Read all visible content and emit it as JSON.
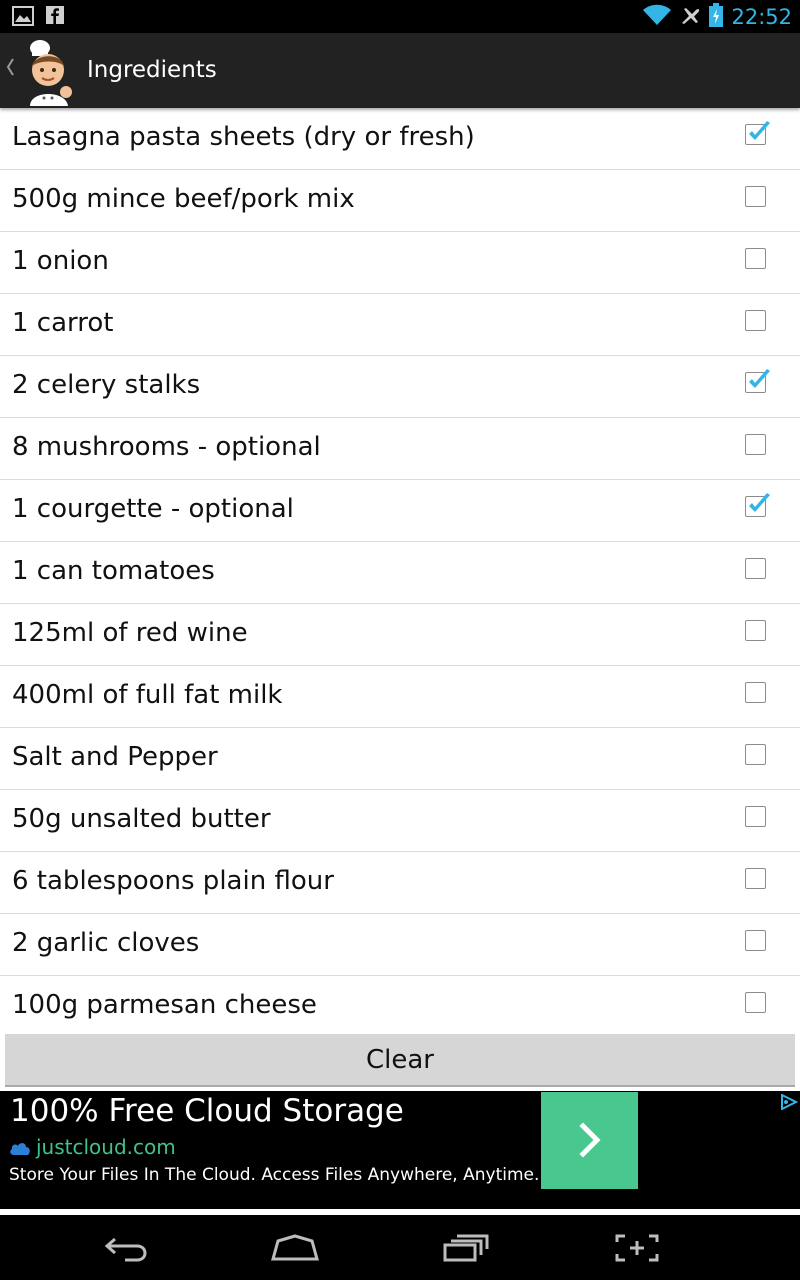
{
  "status_bar": {
    "time": "22:52",
    "left_icons": [
      "gallery-icon",
      "facebook-icon"
    ],
    "right_icons": [
      "wifi-icon",
      "airplane-mode-icon",
      "battery-charging-icon"
    ],
    "accent_color": "#33b5e5"
  },
  "action_bar": {
    "title": "Ingredients",
    "up_icon": "chevron-left-icon",
    "app_icon": "chef-icon"
  },
  "ingredients": [
    {
      "label": "Lasagna pasta sheets (dry or fresh)",
      "checked": true
    },
    {
      "label": "500g mince beef/pork mix",
      "checked": false
    },
    {
      "label": "1 onion",
      "checked": false
    },
    {
      "label": "1 carrot",
      "checked": false
    },
    {
      "label": "2 celery stalks",
      "checked": true
    },
    {
      "label": "8 mushrooms - optional",
      "checked": false
    },
    {
      "label": "1 courgette - optional",
      "checked": true
    },
    {
      "label": "1 can tomatoes",
      "checked": false
    },
    {
      "label": "125ml of red wine",
      "checked": false
    },
    {
      "label": "400ml of full fat milk",
      "checked": false
    },
    {
      "label": "Salt and Pepper",
      "checked": false
    },
    {
      "label": "50g unsalted butter",
      "checked": false
    },
    {
      "label": "6 tablespoons plain flour",
      "checked": false
    },
    {
      "label": "2 garlic cloves",
      "checked": false
    },
    {
      "label": "100g parmesan cheese",
      "checked": false
    }
  ],
  "clear_button": {
    "label": "Clear"
  },
  "ad": {
    "title": "100% Free Cloud Storage",
    "url": "justcloud.com",
    "description": "Store Your Files In The Cloud. Access Files Anywhere, Anytime.",
    "button_color": "#48c78e",
    "url_color": "#3fc38a"
  },
  "nav_bar": {
    "buttons": [
      "back-icon",
      "home-icon",
      "recent-apps-icon",
      "screenshot-icon"
    ]
  }
}
